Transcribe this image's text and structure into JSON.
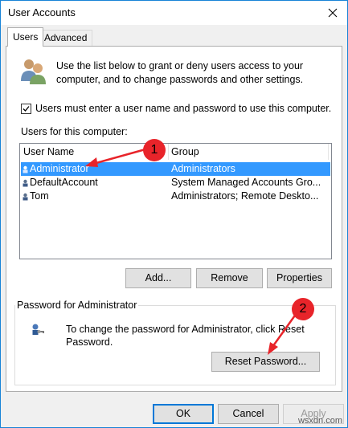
{
  "window": {
    "title": "User Accounts"
  },
  "tabs": [
    {
      "label": "Users"
    },
    {
      "label": "Advanced"
    }
  ],
  "intro": {
    "text": "Use the list below to grant or deny users access to your computer, and to change passwords and other settings."
  },
  "require_login": {
    "label": "Users must enter a user name and password to use this computer.",
    "checked": true
  },
  "users_list": {
    "label": "Users for this computer:",
    "columns": [
      "User Name",
      "Group"
    ],
    "rows": [
      {
        "name": "Administrator",
        "group": "Administrators",
        "selected": true
      },
      {
        "name": "DefaultAccount",
        "group": "System Managed Accounts Gro..."
      },
      {
        "name": "Tom",
        "group": "Administrators; Remote Deskto..."
      }
    ]
  },
  "actions": {
    "add": "Add...",
    "remove": "Remove",
    "properties": "Properties"
  },
  "password": {
    "group_label": "Password for Administrator",
    "text": "To change the password for Administrator, click Reset Password.",
    "reset_button": "Reset Password..."
  },
  "footer": {
    "ok": "OK",
    "cancel": "Cancel",
    "apply": "Apply"
  },
  "callouts": [
    "1",
    "2"
  ],
  "watermark": "wsxdn.com",
  "colors": {
    "selection": "#3399ff",
    "accent": "#0078d7",
    "callout": "#e8242a"
  }
}
